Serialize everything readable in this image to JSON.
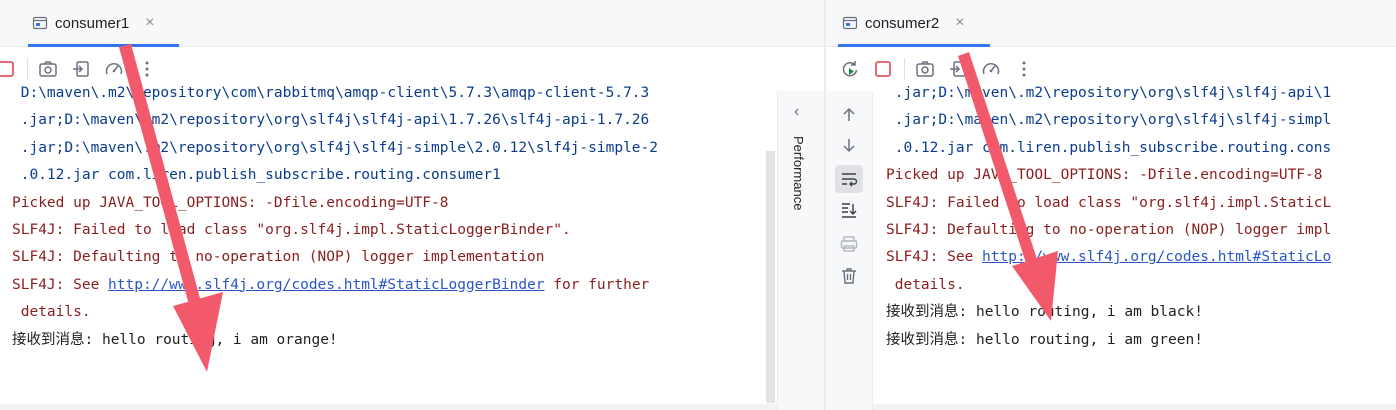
{
  "left": {
    "tab_label": "consumer1",
    "side_label": "Performance",
    "lines": [
      {
        "text": " D:\\maven\\.m2\\repository\\com\\rabbitmq\\amqp-client\\5.7.3\\amqp-client-5.7.3",
        "kind": "cls"
      },
      {
        "text": " .jar;D:\\maven\\.m2\\repository\\org\\slf4j\\slf4j-api\\1.7.26\\slf4j-api-1.7.26",
        "kind": "cls"
      },
      {
        "text": " .jar;D:\\maven\\.m2\\repository\\org\\slf4j\\slf4j-simple\\2.0.12\\slf4j-simple-2",
        "kind": "cls"
      },
      {
        "text": " .0.12.jar com.liren.publish_subscribe.routing.consumer1",
        "kind": "cls"
      },
      {
        "text": "Picked up JAVA_TOOL_OPTIONS: -Dfile.encoding=UTF-8",
        "kind": "err"
      },
      {
        "text": "SLF4J: Failed to load class \"org.slf4j.impl.StaticLoggerBinder\".",
        "kind": "err"
      },
      {
        "text": "SLF4J: Defaulting to no-operation (NOP) logger implementation",
        "kind": "err"
      },
      {
        "prefix": "SLF4J: See ",
        "link": "http://www.slf4j.org/codes.html#StaticLoggerBinder",
        "suffix": " for further",
        "kind": "err"
      },
      {
        "text": " details.",
        "kind": "err"
      },
      {
        "text": "接收到消息: hello routing, i am orange!",
        "kind": "out"
      }
    ]
  },
  "right": {
    "tab_label": "consumer2",
    "lines": [
      {
        "text": " .jar;D:\\maven\\.m2\\repository\\org\\slf4j\\slf4j-api\\1",
        "kind": "cls"
      },
      {
        "text": " .jar;D:\\maven\\.m2\\repository\\org\\slf4j\\slf4j-simpl",
        "kind": "cls"
      },
      {
        "text": " .0.12.jar com.liren.publish_subscribe.routing.cons",
        "kind": "cls"
      },
      {
        "text": "Picked up JAVA_TOOL_OPTIONS: -Dfile.encoding=UTF-8",
        "kind": "err"
      },
      {
        "text": "SLF4J: Failed to load class \"org.slf4j.impl.StaticL",
        "kind": "err"
      },
      {
        "text": "SLF4J: Defaulting to no-operation (NOP) logger impl",
        "kind": "err"
      },
      {
        "prefix": "SLF4J: See ",
        "link": "http://www.slf4j.org/codes.html#StaticLo",
        "suffix": "",
        "kind": "err"
      },
      {
        "text": " details.",
        "kind": "err"
      },
      {
        "text": "接收到消息: hello routing, i am black!",
        "kind": "out"
      },
      {
        "text": "接收到消息: hello routing, i am green!",
        "kind": "out"
      }
    ]
  },
  "icons": {
    "tab": "console-window-icon",
    "stop": "stop-icon",
    "screenshot": "camera-icon",
    "restore": "restore-layout-icon",
    "profiler": "speedometer-icon",
    "more": "more-options-icon",
    "rerun": "rerun-icon",
    "up": "arrow-up-icon",
    "down": "arrow-down-icon",
    "wrap": "soft-wrap-icon",
    "scroll_end": "scroll-to-end-icon",
    "print": "print-icon",
    "clear": "trash-icon"
  },
  "colors": {
    "accent": "#3574f0",
    "stop": "#e55765",
    "rerun": "#208a3c",
    "annotation_arrow": "#f25a6b",
    "stderr": "#8a1e1e",
    "classpath": "#0b3c8c"
  }
}
